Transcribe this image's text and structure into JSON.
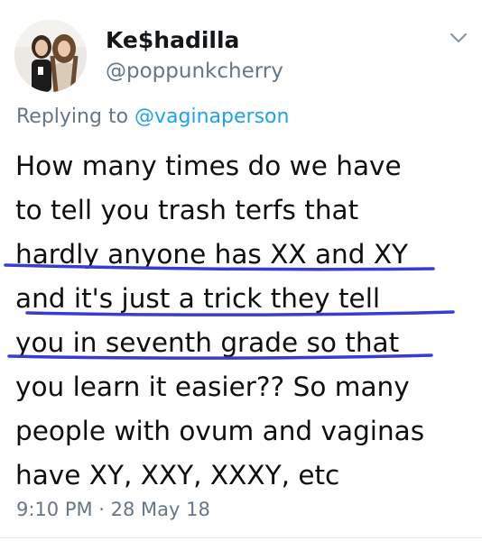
{
  "user": {
    "display_name": "Ke$hadilla",
    "handle": "@poppunkcherry",
    "avatar_icon": "profile-photo"
  },
  "reply": {
    "prefix": "Replying to ",
    "mention": "@vaginaperson"
  },
  "tweet": {
    "lines": [
      "How many times do we have",
      "to tell you trash terfs that",
      "hardly anyone has XX and XY",
      "and it's just a trick they tell",
      "you in seventh grade so that",
      "you learn it easier?? So many",
      "people with ovum and vaginas",
      "have XY, XXY, XXXY, etc"
    ],
    "timestamp": "9:10 PM · 28 May 18"
  },
  "menu_icon": "chevron-down-icon",
  "colors": {
    "secondary_text": "#657786",
    "mention": "#1da1f2",
    "highlight_underline": "#3a3ad6"
  }
}
